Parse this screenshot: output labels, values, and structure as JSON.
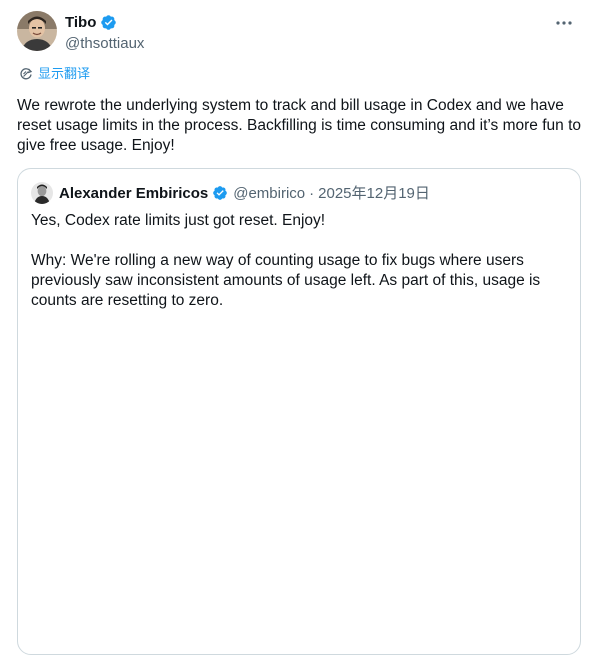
{
  "author": {
    "name": "Tibo",
    "handle": "@thsottiaux",
    "avatar_icon": "user-avatar",
    "verified_icon": "verified-badge-icon",
    "verified_color": "#1d9bf0"
  },
  "menu": {
    "more_icon": "more-horizontal-icon"
  },
  "translate": {
    "icon": "translate-icon",
    "label": "显示翻译",
    "color": "#1d9bf0"
  },
  "body": {
    "text": "We rewrote the underlying system to track and bill usage in Codex and we have reset usage limits in the process. Backfilling is time consuming and it’s more fun to give free usage. Enjoy!"
  },
  "quote": {
    "author": {
      "name": "Alexander Embiricos",
      "handle": "@embirico",
      "separator": "·",
      "date": "2025年12月19日",
      "verified_icon": "verified-badge-icon"
    },
    "paragraphs": [
      "Yes, Codex rate limits just got reset. Enjoy!",
      "Why: We're rolling a new way of counting usage to fix bugs where users previously saw inconsistent amounts of usage left. As part of this, usage is counts are resetting to zero."
    ]
  }
}
